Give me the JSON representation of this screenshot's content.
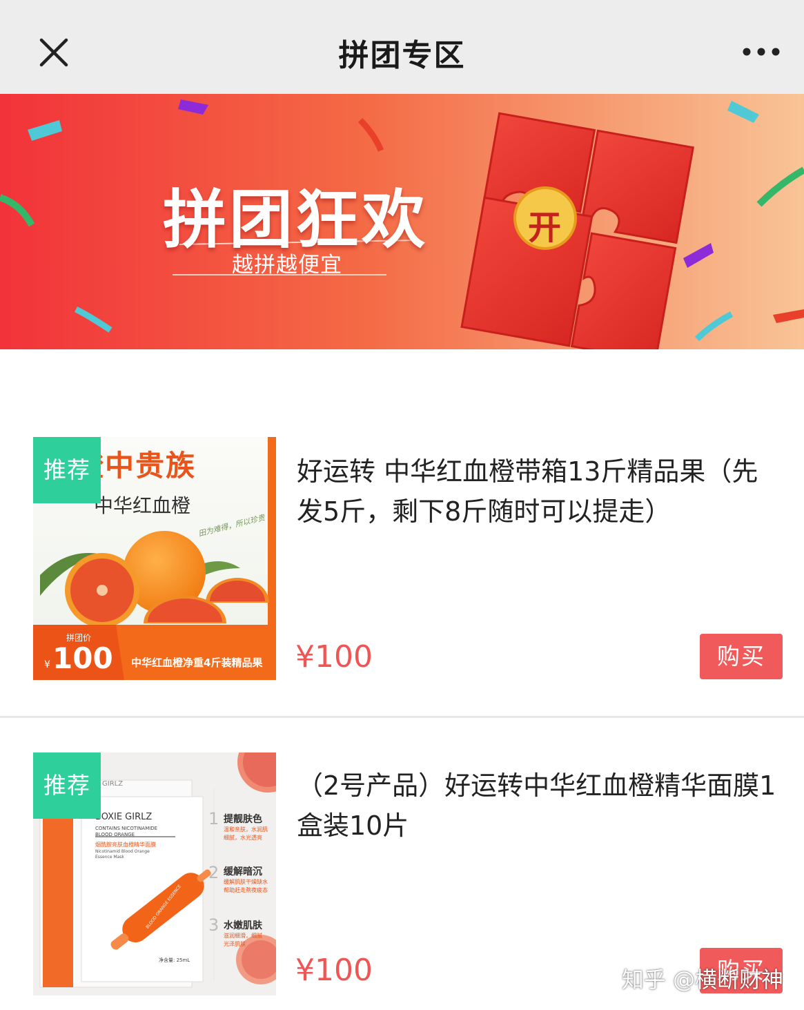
{
  "navbar": {
    "title": "拼团专区",
    "close_icon": "close-icon",
    "more_icon": "more-dots-icon"
  },
  "banner": {
    "title": "拼团狂欢",
    "subtitle": "越拼越便宜",
    "badge": "开",
    "colors": {
      "left": "#f23a3a",
      "right": "#f7b98c",
      "envelope": "#e8302c",
      "coin": "#f5c542"
    }
  },
  "products": [
    {
      "tag": "推荐",
      "title": "好运转 中华红血橙带箱13斤精品果（先发5斤，剩下8斤随时可以提走）",
      "price": "¥100",
      "buy_label": "购买",
      "image_text": {
        "headline": "橙中贵族",
        "sub": "中华红血橙",
        "script": "田为难得，所以珍贵",
        "price_label": "拼团价",
        "price_currency": "¥",
        "price_value": "100",
        "footer": "中华红血橙净重4斤装精品果"
      }
    },
    {
      "tag": "推荐",
      "title": "（2号产品）好运转中华红血橙精华面膜1盒装10片",
      "price": "¥100",
      "buy_label": "购买",
      "image_text": {
        "brand": "BOXIE GIRLZ",
        "brand_short": "GIRLZ",
        "pack_line1": "CONTAINS NICOTINAMIDE",
        "pack_line2": "BLOOD ORANGE",
        "pack_cn": "烟酰胺亮肤血橙精华面膜",
        "pack_en1": "Nicotinamid Blood Orange",
        "pack_en2": "Essence Mask",
        "volume": "净含量: 25mL",
        "ampoule_label": "BLOOD ORANGE ESSENCE",
        "features": [
          {
            "num": "1",
            "title": "提靓肤色",
            "desc1": "温和亲肤，水润肌",
            "desc2": "细腻，水光透亮"
          },
          {
            "num": "2",
            "title": "缓解暗沉",
            "desc1": "缓解肌肤干燥缺水",
            "desc2": "帮助赶走熬夜疲态"
          },
          {
            "num": "3",
            "title": "水嫩肌肤",
            "desc1": "滋润细滑，细腻",
            "desc2": "光泽肌肤"
          }
        ]
      }
    }
  ],
  "watermark": "知乎 @横断财神",
  "accent_colors": {
    "price": "#f05555",
    "buy": "#f05a5a",
    "tag": "#2fcf9c"
  }
}
